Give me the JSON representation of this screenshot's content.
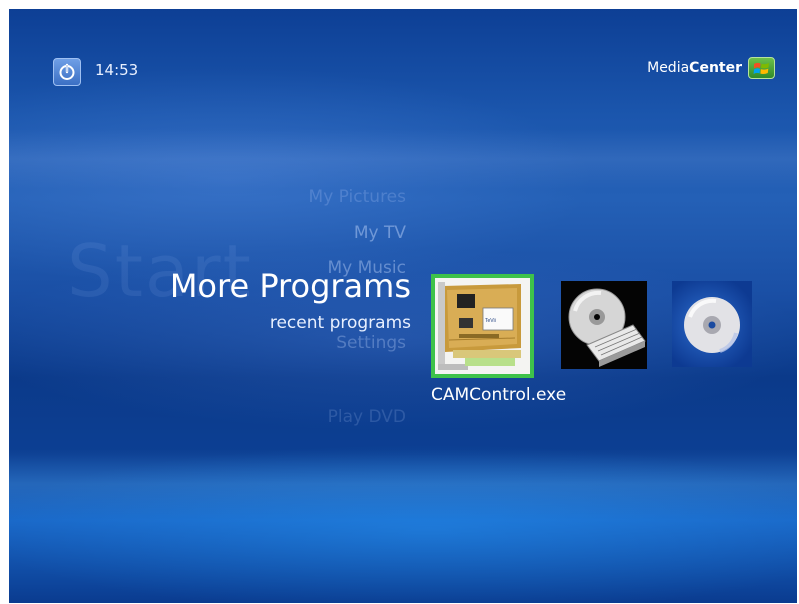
{
  "status": {
    "clock": "14:53"
  },
  "brand": {
    "prefix": "Media",
    "bold": "Center"
  },
  "background_label": "Start",
  "menu": {
    "items": [
      "My Pictures",
      "My TV",
      "My Music",
      "Settings",
      "Play DVD"
    ],
    "selected": {
      "title": "More Programs",
      "subtitle": "recent programs"
    }
  },
  "programs": {
    "focused_caption": "CAMControl.exe",
    "tiles": [
      {
        "name": "CAMControl.exe",
        "icon": "capture-card-icon",
        "focused": true
      },
      {
        "name": "",
        "icon": "cd-keyboard-icon",
        "focused": false
      },
      {
        "name": "",
        "icon": "cd-icon",
        "focused": false
      }
    ]
  },
  "colors": {
    "focus_border": "#3ec24a",
    "background": "#1a4fa5"
  }
}
